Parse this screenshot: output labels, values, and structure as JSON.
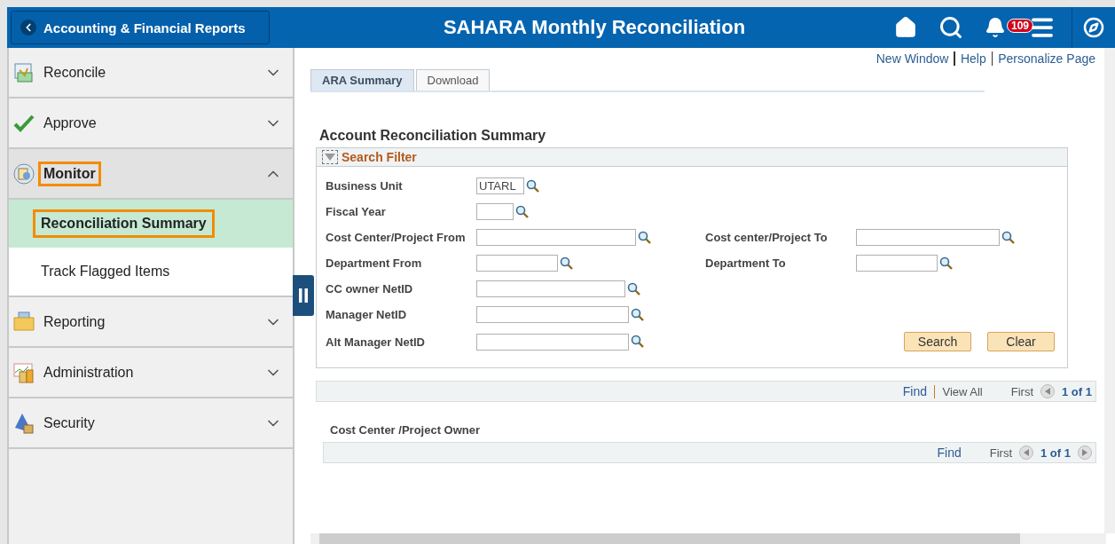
{
  "header": {
    "back_label": "Accounting & Financial Reports",
    "title": "SAHARA Monthly Reconciliation",
    "notification_count": "109"
  },
  "sidebar": {
    "items": [
      {
        "label": "Reconcile",
        "expanded": false,
        "highlighted": false
      },
      {
        "label": "Approve",
        "expanded": false,
        "highlighted": false
      },
      {
        "label": "Monitor",
        "expanded": true,
        "highlighted": true,
        "children": [
          {
            "label": "Reconciliation Summary",
            "selected": true,
            "highlighted": true
          },
          {
            "label": "Track Flagged Items",
            "selected": false,
            "highlighted": false
          }
        ]
      },
      {
        "label": "Reporting",
        "expanded": false,
        "highlighted": false
      },
      {
        "label": "Administration",
        "expanded": false,
        "highlighted": false
      },
      {
        "label": "Security",
        "expanded": false,
        "highlighted": false
      }
    ]
  },
  "top_links": [
    "New Window",
    "Help",
    "Personalize Page"
  ],
  "tabs": [
    {
      "label": "ARA Summary",
      "selected": true
    },
    {
      "label": "Download",
      "selected": false
    }
  ],
  "page_title": "Account Reconciliation Summary",
  "search_filter": {
    "title": "Search Filter",
    "expanded": true,
    "rows": [
      {
        "left": {
          "label": "Business Unit",
          "value": "UTARL"
        }
      },
      {
        "left": {
          "label": "Fiscal Year"
        }
      },
      {
        "left": {
          "label": "Cost Center/Project From"
        },
        "right": {
          "label": "Cost center/Project To"
        }
      },
      {
        "left": {
          "label": "Department From"
        },
        "right": {
          "label": "Department To"
        }
      },
      {
        "left": {
          "label": "CC owner NetID"
        }
      },
      {
        "left": {
          "label": "Manager NetID"
        }
      },
      {
        "left": {
          "label": "Alt Manager NetID"
        }
      }
    ],
    "buttons": [
      "Search",
      "Clear"
    ]
  },
  "results_grid": {
    "links": [
      "Find",
      "View All"
    ],
    "first": "First",
    "page": "1 of 1"
  },
  "owner_grid": {
    "title": "Cost Center /Project Owner",
    "find": "Find",
    "first": "First",
    "page": "1 of 1"
  }
}
